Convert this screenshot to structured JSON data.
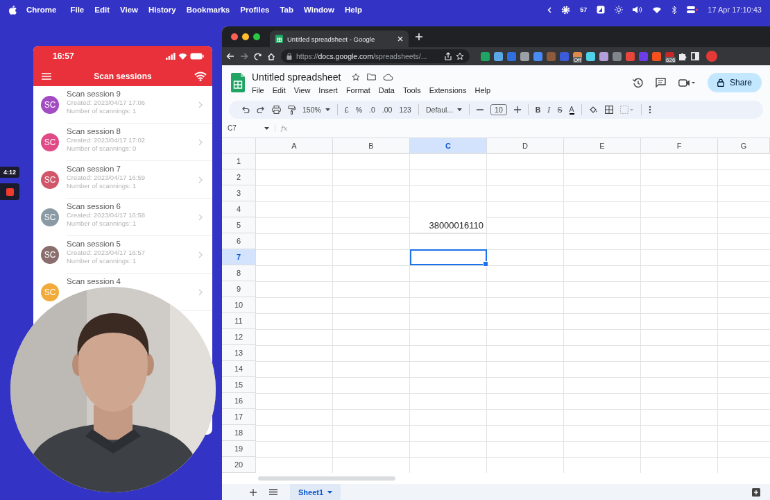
{
  "menu_bar": {
    "app_name": "Chrome",
    "menus": [
      "File",
      "Edit",
      "View",
      "History",
      "Bookmarks",
      "Profiles",
      "Tab",
      "Window",
      "Help"
    ],
    "status_number": "57",
    "clock": "17 Apr  17:10:43"
  },
  "recording": {
    "timer": "4:12"
  },
  "phone": {
    "time": "16:57",
    "title": "Scan sessions",
    "sessions": [
      {
        "initials": "SC",
        "color": "#a24bc3",
        "title": "Scan session 9",
        "created": "Created: 2023/04/17 17:06",
        "count": "Number of scannings: 1"
      },
      {
        "initials": "SC",
        "color": "#e04a86",
        "title": "Scan session 8",
        "created": "Created: 2023/04/17 17:02",
        "count": "Number of scannings: 0"
      },
      {
        "initials": "SC",
        "color": "#d2566a",
        "title": "Scan session 7",
        "created": "Created: 2023/04/17 16:59",
        "count": "Number of scannings: 1"
      },
      {
        "initials": "SC",
        "color": "#8a9aa5",
        "title": "Scan session 6",
        "created": "Created: 2023/04/17 16:58",
        "count": "Number of scannings: 1"
      },
      {
        "initials": "SC",
        "color": "#8a6e6e",
        "title": "Scan session 5",
        "created": "Created: 2023/04/17 16:57",
        "count": "Number of scannings: 1"
      },
      {
        "initials": "SC",
        "color": "#f2aa3a",
        "title": "Scan session 4"
      }
    ]
  },
  "browser": {
    "tab_title": "Untitled spreadsheet - Google",
    "url": "https://**docs.google.com**/spreadsheets/...",
    "extensions": [
      {
        "color": "#1fa463"
      },
      {
        "color": "#5aa9e6"
      },
      {
        "color": "#2f6fe0"
      },
      {
        "color": "#9aa0a6"
      },
      {
        "color": "#4a8af4"
      },
      {
        "color": "#8d5a3b"
      },
      {
        "color": "#3b5bdb"
      },
      {
        "color": "#e0894a",
        "badge": "Off"
      },
      {
        "color": "#4fd1e8"
      },
      {
        "color": "#b39ddb"
      },
      {
        "color": "#80868b"
      },
      {
        "color": "#e8453c"
      },
      {
        "color": "#6a3de8"
      },
      {
        "color": "#f4511e"
      },
      {
        "color": "#c62828",
        "badge": "626"
      }
    ]
  },
  "sheets": {
    "title": "Untitled spreadsheet",
    "menus": [
      "File",
      "Edit",
      "View",
      "Insert",
      "Format",
      "Data",
      "Tools",
      "Extensions",
      "Help"
    ],
    "share": "Share",
    "toolbar": {
      "zoom": "150%",
      "currency": "£",
      "percent": "%",
      "decrease_decimals": ".0",
      "increase_decimals": ".00",
      "number_format": "123",
      "font": "Defaul...",
      "font_size": "10",
      "bold": "B",
      "italic": "I",
      "strikethrough": "S",
      "text_color": "A"
    },
    "name_box": "C7",
    "formula_label": "fx",
    "columns": [
      {
        "label": "A",
        "selected": false
      },
      {
        "label": "B",
        "selected": false
      },
      {
        "label": "C",
        "selected": true
      },
      {
        "label": "D",
        "selected": false
      },
      {
        "label": "E",
        "selected": false
      },
      {
        "label": "F",
        "selected": false
      },
      {
        "label": "G",
        "selected": false
      }
    ],
    "rows": [
      {
        "label": "1",
        "selected": false
      },
      {
        "label": "2",
        "selected": false
      },
      {
        "label": "3",
        "selected": false
      },
      {
        "label": "4",
        "selected": false
      },
      {
        "label": "5",
        "selected": false,
        "cells": [
          null,
          null,
          "38000016110"
        ]
      },
      {
        "label": "6",
        "selected": false
      },
      {
        "label": "7",
        "selected": true
      },
      {
        "label": "8",
        "selected": false
      },
      {
        "label": "9",
        "selected": false
      },
      {
        "label": "10",
        "selected": false
      },
      {
        "label": "11",
        "selected": false
      },
      {
        "label": "12",
        "selected": false
      },
      {
        "label": "13",
        "selected": false
      },
      {
        "label": "14",
        "selected": false
      },
      {
        "label": "15",
        "selected": false
      },
      {
        "label": "16",
        "selected": false
      },
      {
        "label": "17",
        "selected": false
      },
      {
        "label": "18",
        "selected": false
      },
      {
        "label": "19",
        "selected": false
      },
      {
        "label": "20",
        "selected": false
      }
    ],
    "sheet_tabs": [
      {
        "label": "Sheet1",
        "selected": true
      }
    ]
  }
}
